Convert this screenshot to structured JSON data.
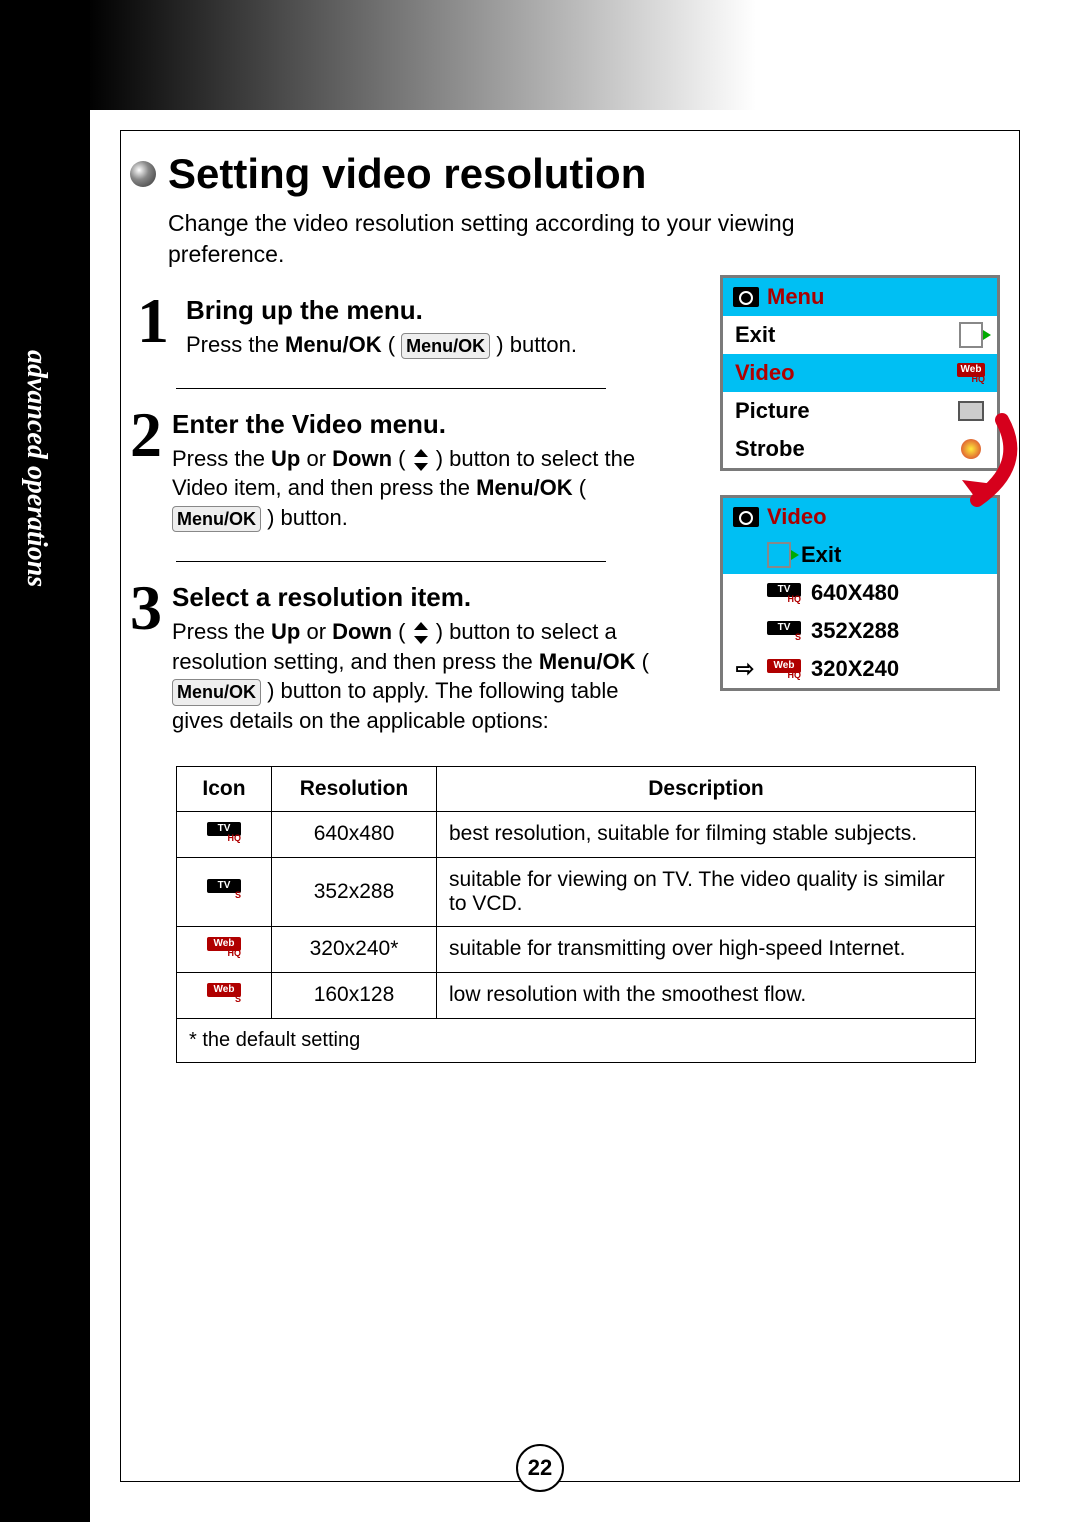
{
  "side_label": "advanced operations",
  "title": "Setting video resolution",
  "intro": "Change the video resolution setting according to your viewing preference.",
  "steps": [
    {
      "num": "1",
      "title": "Bring up the menu.",
      "desc_parts": [
        "Press the ",
        "Menu/OK",
        " ( ",
        "Menu/OK",
        " ) button."
      ]
    },
    {
      "num": "2",
      "title": "Enter the Video menu.",
      "desc_parts": [
        "Press the ",
        "Up",
        " or ",
        "Down",
        " ( ",
        "UPDOWN",
        " ) button to select the Video item, and then press the ",
        "Menu/OK",
        " ( ",
        "Menu/OK",
        " ) button."
      ]
    },
    {
      "num": "3",
      "title": "Select a resolution item.",
      "desc_parts": [
        "Press the ",
        "Up",
        " or ",
        "Down",
        " ( ",
        "UPDOWN",
        " ) button to select a resolution setting, and then press the ",
        "Menu/OK",
        " ( ",
        "Menu/OK",
        " ) button to apply. The following table gives details on the applicable options:"
      ]
    }
  ],
  "menu": {
    "header": "Menu",
    "items": [
      {
        "label": "Exit",
        "icon": "exit"
      },
      {
        "label": "Video",
        "icon": "video",
        "selected": true
      },
      {
        "label": "Picture",
        "icon": "picture"
      },
      {
        "label": "Strobe",
        "icon": "strobe"
      }
    ]
  },
  "video_menu": {
    "header": "Video",
    "items": [
      {
        "label": "Exit",
        "icon": "exit",
        "selected": true,
        "arrow": false
      },
      {
        "label": "640X480",
        "icon": "tv-hq",
        "arrow": false
      },
      {
        "label": "352X288",
        "icon": "tv-s",
        "arrow": false
      },
      {
        "label": "320X240",
        "icon": "web-hq",
        "arrow": true
      }
    ]
  },
  "table": {
    "headers": [
      "Icon",
      "Resolution",
      "Description"
    ],
    "rows": [
      {
        "icon": {
          "top": "TV",
          "bot": "HQ",
          "variant": "tv-hq"
        },
        "resolution": "640x480",
        "description": "best resolution, suitable for filming stable subjects."
      },
      {
        "icon": {
          "top": "TV",
          "bot": "S",
          "variant": "tv-s"
        },
        "resolution": "352x288",
        "description": "suitable for viewing on TV. The video quality is similar to VCD."
      },
      {
        "icon": {
          "top": "Web",
          "bot": "HQ",
          "variant": "web-hq"
        },
        "resolution": "320x240*",
        "description": "suitable for transmitting over high-speed Internet."
      },
      {
        "icon": {
          "top": "Web",
          "bot": "S",
          "variant": "web-s"
        },
        "resolution": "160x128",
        "description": "low resolution with the smoothest flow."
      }
    ],
    "footnote": "* the default setting"
  },
  "page_number": "22"
}
